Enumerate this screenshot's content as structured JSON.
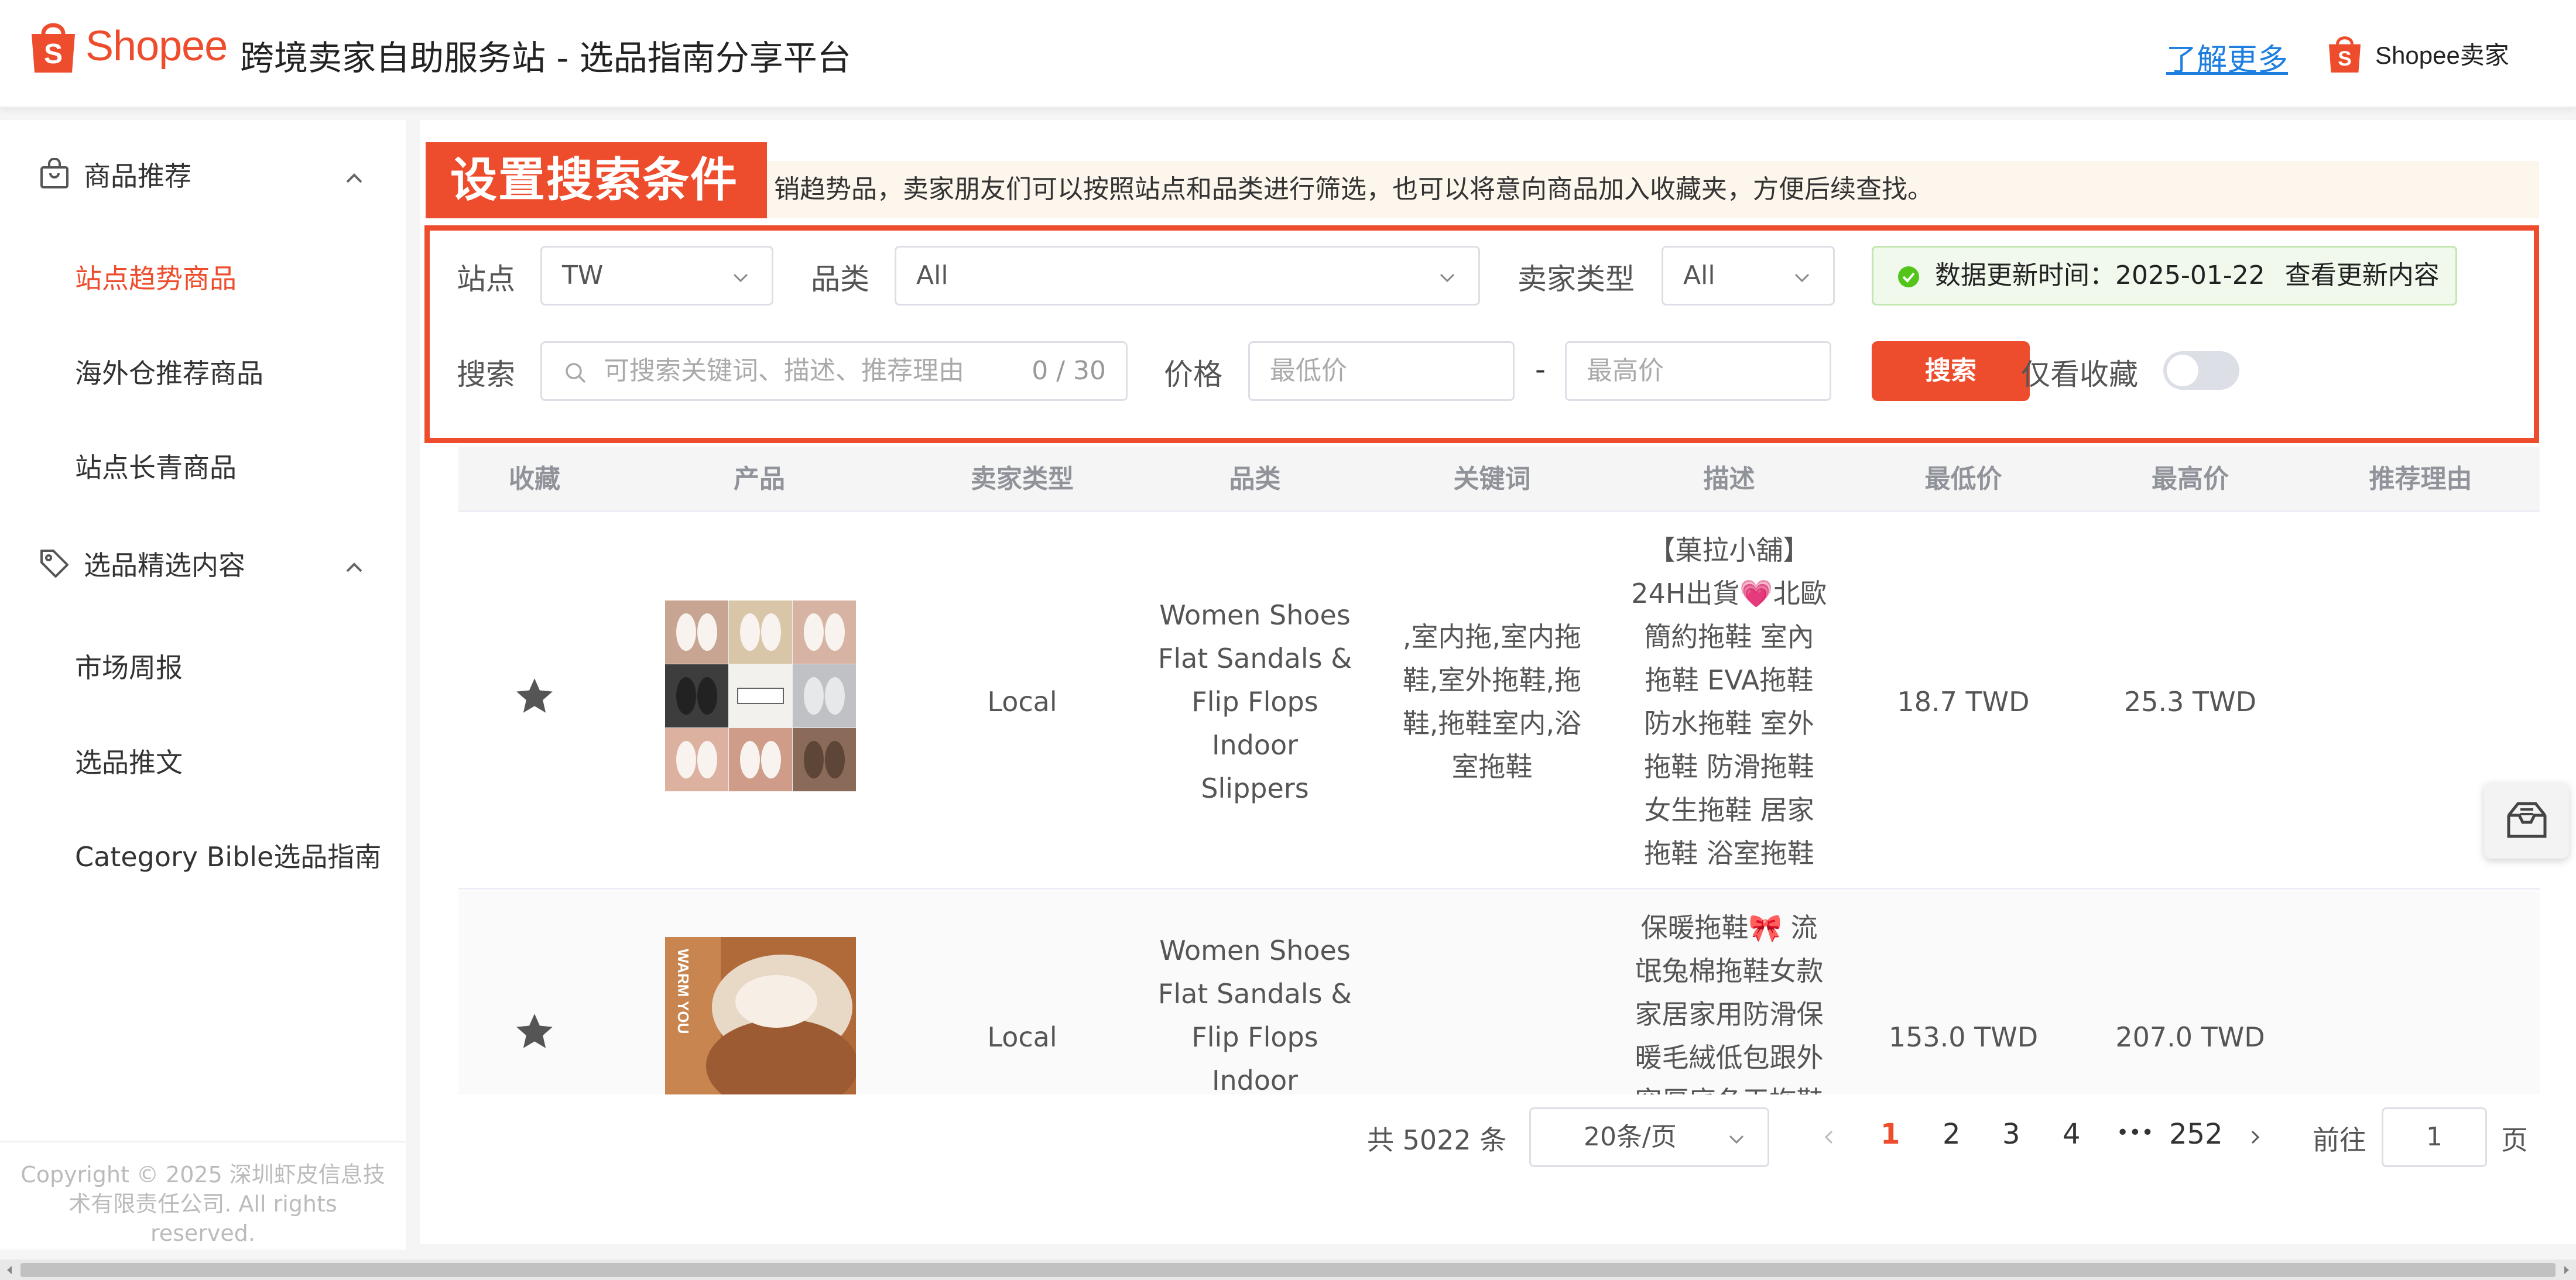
{
  "header": {
    "brand": "Shopee",
    "site_title": "跨境卖家自助服务站 - 选品指南分享平台",
    "learn_more": "了解更多",
    "seller_brand": "Shopee卖家"
  },
  "sidebar": {
    "group1": {
      "label": "商品推荐",
      "icon": "bag-icon"
    },
    "group1_items": [
      "站点趋势商品",
      "海外仓推荐商品",
      "站点长青商品"
    ],
    "group2": {
      "label": "选品精选内容",
      "icon": "tag-icon"
    },
    "group2_items": [
      "市场周报",
      "选品推文",
      "Category Bible选品指南"
    ],
    "footer": "Copyright © 2025 深圳虾皮信息技术有限责任公司. All rights reserved."
  },
  "notice": {
    "text": "销趋势品，卖家朋友们可以按照站点和品类进行筛选，也可以将意向商品加入收藏夹，方便后续查找。",
    "overlay_label": "设置搜索条件"
  },
  "filters": {
    "site_label": "站点",
    "site_value": "TW",
    "category_label": "品类",
    "category_value": "All",
    "seller_type_label": "卖家类型",
    "seller_type_value": "All",
    "update_text": "数据更新时间：2025-01-22",
    "update_link": "查看更新内容",
    "search_label": "搜索",
    "search_placeholder": "可搜索关键词、描述、推荐理由",
    "search_count": "0 / 30",
    "price_label": "价格",
    "price_min_placeholder": "最低价",
    "price_dash": "-",
    "price_max_placeholder": "最高价",
    "search_button": "搜索",
    "favorites_only_label": "仅看收藏",
    "favorites_only_on": false
  },
  "table": {
    "columns": [
      "收藏",
      "产品",
      "卖家类型",
      "品类",
      "关键词",
      "描述",
      "最低价",
      "最高价",
      "推荐理由"
    ],
    "rows": [
      {
        "seller_type": "Local",
        "category": "Women Shoes Flat Sandals & Flip Flops Indoor Slippers",
        "keywords": ",室内拖,室内拖鞋,室外拖鞋,拖鞋,拖鞋室内,浴室拖鞋",
        "description": "【菓拉小舖】24H出貨💗北歐簡約拖鞋 室內拖鞋 EVA拖鞋 防水拖鞋 室外拖鞋 防滑拖鞋 女生拖鞋 居家拖鞋 浴室拖鞋",
        "min_price": "18.7 TWD",
        "max_price": "25.3 TWD",
        "reason": "",
        "favorited": true
      },
      {
        "seller_type": "Local",
        "category": "Women Shoes Flat Sandals & Flip Flops Indoor Slippers",
        "keywords": "",
        "description": "保暖拖鞋🎀 流氓兔棉拖鞋女款家居家用防滑保暖毛絨低包跟外穿厚底冬天拖鞋",
        "min_price": "153.0 TWD",
        "max_price": "207.0 TWD",
        "reason": "",
        "favorited": true
      }
    ]
  },
  "pagination": {
    "total": "共 5022 条",
    "page_size": "20条/页",
    "pages": [
      "1",
      "2",
      "3",
      "4"
    ],
    "ellipsis": "•••",
    "last_page": "252",
    "current": "1",
    "goto_label": "前往",
    "goto_value": "1",
    "page_suffix": "页"
  },
  "colors": {
    "brand": "#ee4d2d",
    "link": "#1d7fe0",
    "success": "#52c41a"
  }
}
